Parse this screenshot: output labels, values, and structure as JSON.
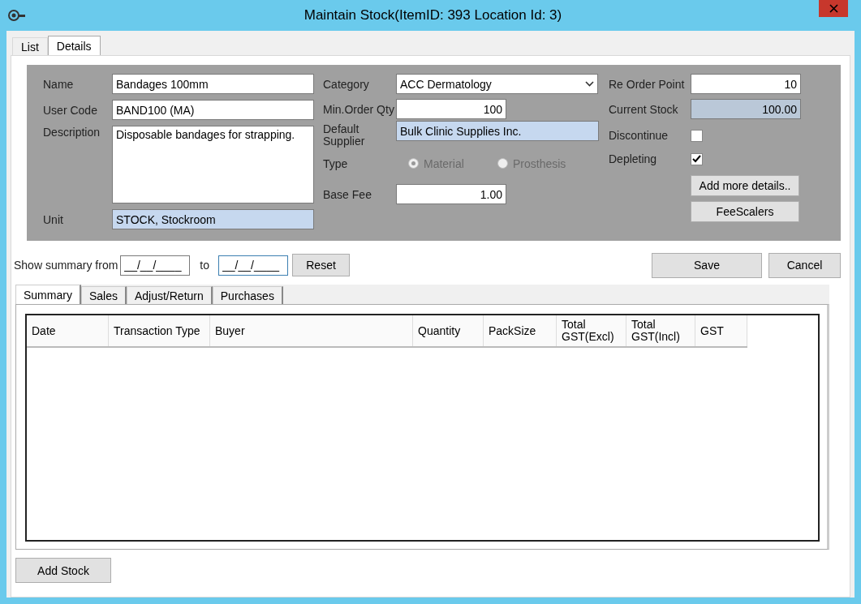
{
  "window": {
    "title": "Maintain Stock(ItemID: 393 Location Id: 3)"
  },
  "tabs": [
    {
      "label": "List",
      "selected": false
    },
    {
      "label": "Details",
      "selected": true
    }
  ],
  "details": {
    "name": {
      "label": "Name",
      "value": "Bandages 100mm"
    },
    "user_code": {
      "label": "User Code",
      "value": "BAND100 (MA)"
    },
    "description": {
      "label": "Description",
      "value": "Disposable bandages for strapping."
    },
    "unit": {
      "label": "Unit",
      "value": "STOCK, Stockroom"
    },
    "category": {
      "label": "Category",
      "value": "ACC Dermatology"
    },
    "min_order_qty": {
      "label": "Min.Order Qty",
      "value": "100"
    },
    "default_supplier": {
      "label": "Default Supplier",
      "value": "Bulk Clinic Supplies Inc."
    },
    "type": {
      "label": "Type",
      "disabled": true,
      "options": [
        {
          "label": "Material",
          "selected": true
        },
        {
          "label": "Prosthesis",
          "selected": false
        }
      ]
    },
    "base_fee": {
      "label": "Base Fee",
      "value": "1.00"
    },
    "re_order_point": {
      "label": "Re Order Point",
      "value": "10"
    },
    "current_stock": {
      "label": "Current Stock",
      "value": "100.00"
    },
    "discontinue": {
      "label": "Discontinue",
      "checked": false
    },
    "depleting": {
      "label": "Depleting",
      "checked": true
    },
    "buttons": [
      "Add more details..",
      "FeeScalers"
    ]
  },
  "summary_filter": {
    "label": "Show summary from",
    "from": "__/__/____",
    "to_label": "to",
    "to": "__/__/____",
    "reset": "Reset"
  },
  "actions": [
    "Save",
    "Cancel"
  ],
  "sub_tabs": [
    {
      "label": "Summary",
      "selected": true
    },
    {
      "label": "Sales",
      "selected": false
    },
    {
      "label": "Adjust/Return",
      "selected": false
    },
    {
      "label": "Purchases",
      "selected": false
    }
  ],
  "table": {
    "columns": [
      "Date",
      "Transaction Type",
      "Buyer",
      "Quantity",
      "PackSize",
      "Total GST(Excl)",
      "Total GST(Incl)",
      "GST"
    ]
  },
  "footer_button": "Add Stock"
}
